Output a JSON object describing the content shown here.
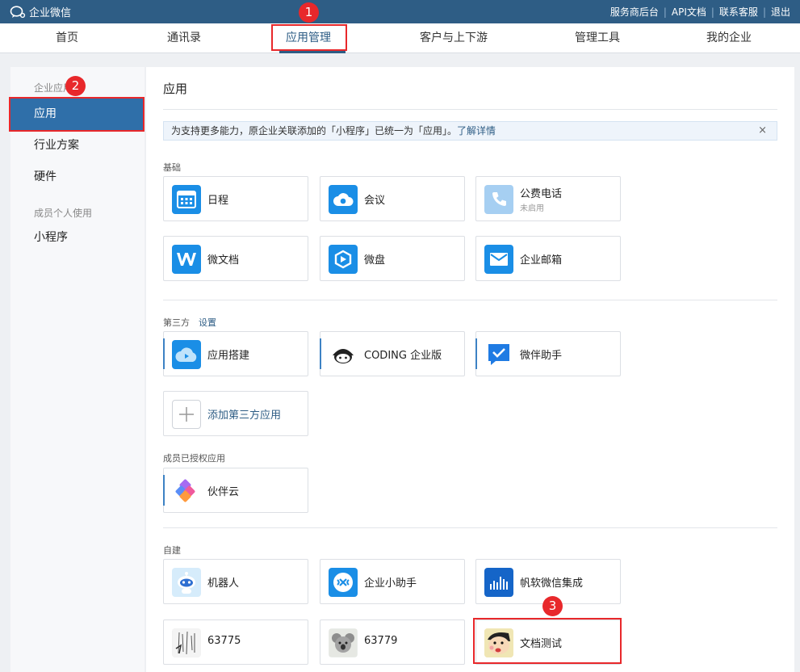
{
  "topbar": {
    "logo_text": "企业微信",
    "links": [
      "服务商后台",
      "API文档",
      "联系客服",
      "退出"
    ]
  },
  "nav": {
    "tabs": [
      "首页",
      "通讯录",
      "应用管理",
      "客户与上下游",
      "管理工具",
      "我的企业"
    ],
    "active_index": 2
  },
  "sidebar": {
    "group1": "企业应用",
    "items1": [
      "应用",
      "行业方案",
      "硬件"
    ],
    "group2": "成员个人使用",
    "items2": [
      "小程序"
    ]
  },
  "main": {
    "title": "应用",
    "notice": {
      "text": "为支持更多能力，原企业关联添加的「小程序」已统一为「应用」。",
      "link": "了解详情",
      "close": "×"
    },
    "basic": {
      "label": "基础",
      "apps": [
        {
          "name": "日程",
          "icon": "calendar-icon"
        },
        {
          "name": "会议",
          "icon": "meeting-cloud-icon"
        },
        {
          "name": "公费电话",
          "sub": "未启用",
          "icon": "phone-icon"
        },
        {
          "name": "微文档",
          "icon": "w-doc-icon"
        },
        {
          "name": "微盘",
          "icon": "drive-icon"
        },
        {
          "name": "企业邮箱",
          "icon": "mail-icon"
        }
      ]
    },
    "third": {
      "label": "第三方",
      "setting": "设置",
      "apps": [
        {
          "name": "应用搭建",
          "icon": "cloud-build-icon"
        },
        {
          "name": "CODING 企业版",
          "icon": "coding-mascot-icon"
        },
        {
          "name": "微伴助手",
          "icon": "checkmark-chat-icon"
        }
      ],
      "add": "添加第三方应用"
    },
    "authorized": {
      "label": "成员已授权应用",
      "apps": [
        {
          "name": "伙伴云",
          "icon": "diamond-logo-icon"
        }
      ]
    },
    "custom": {
      "label": "自建",
      "apps": [
        {
          "name": "机器人",
          "icon": "robot-icon"
        },
        {
          "name": "企业小助手",
          "icon": "assistant-icon"
        },
        {
          "name": "帆软微信集成",
          "icon": "bar-chart-icon"
        },
        {
          "name": "63775",
          "icon": "sketch-image-icon"
        },
        {
          "name": "63779",
          "icon": "koala-image-icon"
        },
        {
          "name": "文档测试",
          "icon": "cartoon-avatar-icon"
        }
      ]
    }
  },
  "annotations": [
    "1",
    "2",
    "3"
  ],
  "colors": {
    "topbar": "#2e5d85",
    "accent": "#2f6fa9",
    "annotation": "#e8282b"
  }
}
